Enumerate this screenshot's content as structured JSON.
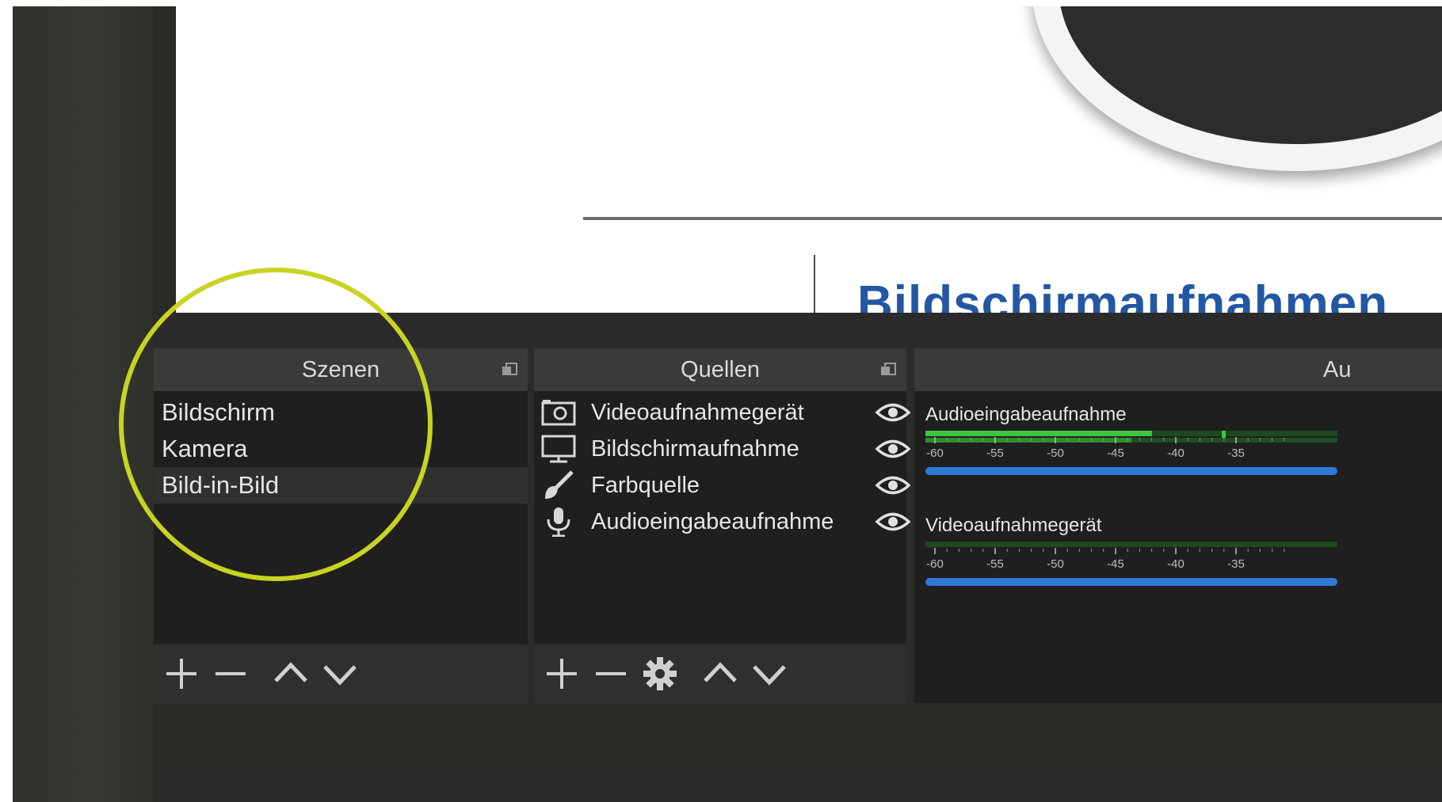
{
  "preview": {
    "heading": "Bildschirmaufnahmen"
  },
  "scenes": {
    "title": "Szenen",
    "items": [
      {
        "label": "Bildschirm",
        "selected": false
      },
      {
        "label": "Kamera",
        "selected": false
      },
      {
        "label": "Bild-in-Bild",
        "selected": true
      }
    ],
    "toolbar": [
      "plus-icon",
      "minus-icon",
      "chevron-up-icon",
      "chevron-down-icon"
    ]
  },
  "sources": {
    "title": "Quellen",
    "items": [
      {
        "label": "Videoaufnahmegerät",
        "icon": "camera-icon",
        "visible": true,
        "locked": false
      },
      {
        "label": "Bildschirmaufnahme",
        "icon": "monitor-icon",
        "visible": true,
        "locked": false
      },
      {
        "label": "Farbquelle",
        "icon": "brush-icon",
        "visible": true,
        "locked": false
      },
      {
        "label": "Audioeingabeaufnahme",
        "icon": "microphone-icon",
        "visible": true,
        "locked": false
      }
    ],
    "toolbar": [
      "plus-icon",
      "minus-icon",
      "gear-icon",
      "chevron-up-icon",
      "chevron-down-icon"
    ]
  },
  "mixer": {
    "title": "Au",
    "channels": [
      {
        "name": "Audioeingabeaufnahme",
        "ticks": [
          "-60",
          "-55",
          "-50",
          "-45",
          "-40",
          "-35"
        ],
        "level": 0.55,
        "peak": 0.72
      },
      {
        "name": "Videoaufnahmegerät",
        "ticks": [
          "-60",
          "-55",
          "-50",
          "-45",
          "-40",
          "-35"
        ],
        "level": 0,
        "peak": 0
      }
    ]
  },
  "colors": {
    "highlight": "#c9d321",
    "slider": "#2f79d8",
    "meter": "#3ec43e"
  }
}
